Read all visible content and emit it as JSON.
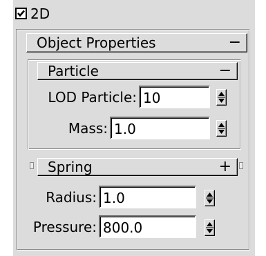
{
  "dimension_toggle": {
    "label": "2D",
    "checked": true
  },
  "object_properties": {
    "title": "Object Properties",
    "collapse_symbol": "−",
    "particle": {
      "title": "Particle",
      "collapse_symbol": "−",
      "lod_particle": {
        "label": "LOD Particle:",
        "value": "10"
      },
      "mass": {
        "label": "Mass:",
        "value": "1.0"
      }
    },
    "spring": {
      "title": "Spring",
      "expand_symbol": "+",
      "radius": {
        "label": "Radius:",
        "value": "1.0"
      },
      "pressure": {
        "label": "Pressure:",
        "value": "800.0"
      }
    }
  }
}
